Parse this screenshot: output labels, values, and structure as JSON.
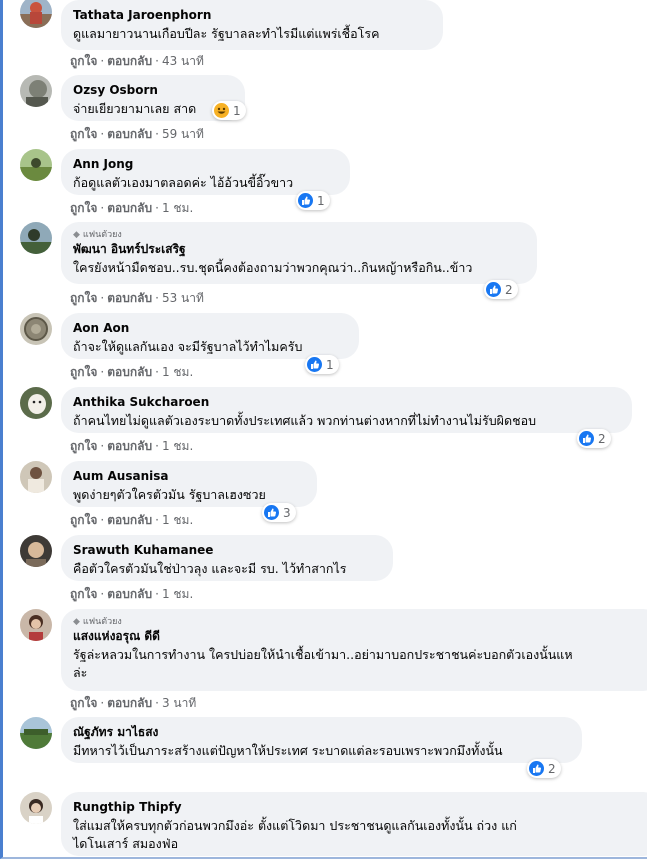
{
  "ui": {
    "like_label": "ถูกใจ",
    "reply_label": "ตอบกลับ",
    "dot": "·",
    "fan_badge": "แฟนตัวยง",
    "colors": {
      "bubble": "#f0f2f5",
      "like_blue": "#1877f2",
      "haha_yellow": "#f7b125",
      "meta_gray": "#65676b"
    }
  },
  "comments": [
    {
      "author": "Tathata Jaroenphorn",
      "text": "ดูแลมายาวนานเกือบปีละ รัฐบาลละทำไรมีแต่แพร่เชื้อโรค",
      "time": "43 นาที",
      "reaction": null
    },
    {
      "author": "Ozsy Osborn",
      "text": "จ่ายเยียวยามาเลย สาด",
      "time": "59 นาที",
      "reaction": {
        "type": "haha-icon",
        "count": "1"
      }
    },
    {
      "author": "Ann Jong",
      "text": "ก้อดูแลตัวเองมาตลอดค่ะ ไอ้อ้วนขี้อิ๊วขาว",
      "time": "1 ชม.",
      "reaction": {
        "type": "like-icon",
        "count": "1"
      }
    },
    {
      "author": "พัฒนา อินทร์ประเสริฐ",
      "fan": true,
      "text": "ใครยังหน้ามืดชอบ..รบ.ชุดนี้คงต้องถามว่าพวกคุณว่า..กินหญ้าหรือกิน..ข้าว",
      "time": "53 นาที",
      "reaction": {
        "type": "like-icon",
        "count": "2"
      }
    },
    {
      "author": "Aon Aon",
      "text": "ถ้าจะให้ดูแลกันเอง จะมีรัฐบาลไว้ทำไมครับ",
      "time": "1 ชม.",
      "reaction": {
        "type": "like-icon",
        "count": "1"
      }
    },
    {
      "author": "Anthika Sukcharoen",
      "text": "ถ้าคนไทยไม่ดูแลตัวเองระบาดทั้งประเทศแล้ว พวกท่านต่างหากที่ไม่ทำงานไม่รับผิดชอบ",
      "time": "1 ชม.",
      "reaction": {
        "type": "like-icon",
        "count": "2"
      }
    },
    {
      "author": "Aum Ausanisa",
      "text": "พูดง่ายๆตัวใครตัวมัน รัฐบาลเฮงซวย",
      "time": "1 ชม.",
      "reaction": {
        "type": "like-icon",
        "count": "3"
      }
    },
    {
      "author": "Srawuth Kuhamanee",
      "text": "คือตัวใครตัวมันใช่ป่าวลุง และจะมี รบ. ไว้ทำสากไร",
      "time": "1 ชม.",
      "reaction": null
    },
    {
      "author": "แสงแห่งอรุณ ดีดี",
      "fan": true,
      "text_line1": "รัฐล่ะหลวมในการทำงาน ใครปบ่อยให้นำเชื้อเข้ามา..อย่ามาบอกประชาชนค่ะบอกตัวเองนั้นแห",
      "text_line2": "ล่ะ",
      "time": "3 นาที",
      "reaction": null
    },
    {
      "author": "ณัฐภัทร มาไธสง",
      "text": "มีทหารไว้เป็นภาระสร้างแต่ปัญหาให้ประเทศ ระบาดแต่ละรอบเพราะพวกมึงทั้งนั้น",
      "time": "",
      "reaction": {
        "type": "like-icon",
        "count": "2"
      }
    },
    {
      "author": "Rungthip Thipfy",
      "text_line1": "ใส่แมสให้ครบทุกตัวก่อนพวกมึงอ่ะ ตั้งแต่โวิดมา ประชาชนดูแลกันเองทั้งนั้น ถ่วง แก่",
      "text_line2": "ไดโนเสาร์ สมองฟ่อ",
      "time": "",
      "reaction": null
    }
  ]
}
